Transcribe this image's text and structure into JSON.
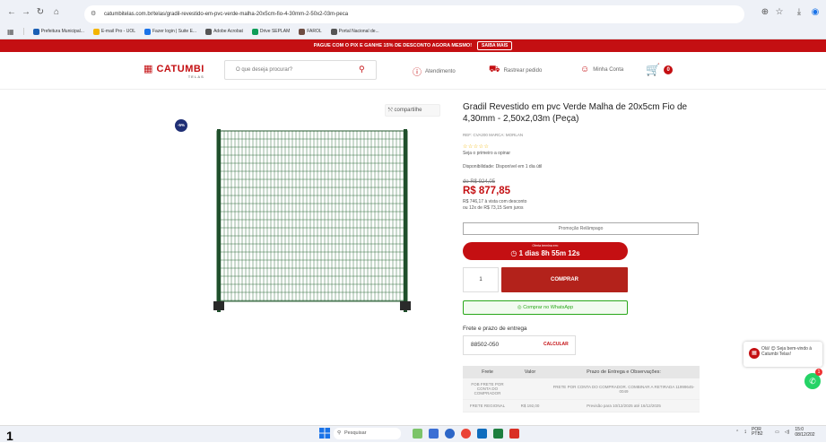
{
  "browser": {
    "url": "catumbitelas.com.br/telas/gradil-revestido-em-pvc-verde-malha-20x5cm-fio-4-30mm-2-50x2-03m-peca",
    "bookmarks": [
      {
        "label": "Prefeitura Municipal...",
        "color": "#1a5fb4"
      },
      {
        "label": "E-mail Pro - UOL",
        "color": "#f4b400"
      },
      {
        "label": "Fazer login | Suite E...",
        "color": "#1a73e8"
      },
      {
        "label": "Adobe Acrobat",
        "color": "#555"
      },
      {
        "label": "Drive SEPLAM",
        "color": "#0f9d58"
      },
      {
        "label": "FAROL",
        "color": "#6d4c41"
      },
      {
        "label": "Portal Nacional de...",
        "color": "#555"
      }
    ]
  },
  "promo": {
    "text": "PAGUE COM O PIX E GANHE 15% DE DESCONTO AGORA MESMO!",
    "button": "SAIBA MAIS"
  },
  "header": {
    "logo": "CATUMBI",
    "logo_sub": "TELAS",
    "search_placeholder": "O que deseja procurar?",
    "atendimento": "Atendimento",
    "rastrear": "Rastrear pedido",
    "conta": "Minha Conta",
    "cart_count": "0"
  },
  "product": {
    "share": "compartilhe",
    "discount": "-5%",
    "title": "Gradil Revestido em pvc Verde Malha de 20x5cm Fio de 4,30mm - 2,50x2,03m (Peça)",
    "ref": "REF: CVA200    MARCA: MORLAN",
    "stars": "☆☆☆☆☆",
    "review": "Seja o primeiro a opinar",
    "availability": "Disponibilidade: Disponível em 1 dia útil",
    "old_price": "de R$ 924,05",
    "price": "R$ 877,85",
    "cash_line1": "R$ 746,17 à vista com desconto",
    "cash_line2": "ou 12x de R$ 73,15 Sem juros",
    "flash": "Promoção Relâmpago",
    "timer_label": "Oferta termina em:",
    "timer_value": "1 dias 8h 55m 12s",
    "qty": "1",
    "buy": "COMPRAR",
    "whatsapp": "Comprar no WhatsApp"
  },
  "frete": {
    "heading": "Frete e prazo de entrega",
    "cep": "88502-050",
    "calc": "CALCULAR",
    "columns": [
      "Frete",
      "Valor",
      "Prazo de Entrega e Observações:"
    ],
    "rows": [
      [
        "FOB FRETE POR CONTA DO COMPRADOR",
        "",
        "FRETE POR CONTA DO COMPRADOR. COMBINAR A RETIRADA 11999645-0049"
      ],
      [
        "FRETE REGIONAL",
        "R$ 192,00",
        "Previsão para 10/12/2025 até 16/12/2025"
      ]
    ]
  },
  "chat": {
    "text": "Olá! 😊 Seja bem-vindo à Catumbi Telas!",
    "badge": "1"
  },
  "taskbar": {
    "left_number": "1",
    "search": "Pesquisar",
    "lang": "POR PTB2",
    "time": "15:0",
    "date": "08/12/202"
  }
}
